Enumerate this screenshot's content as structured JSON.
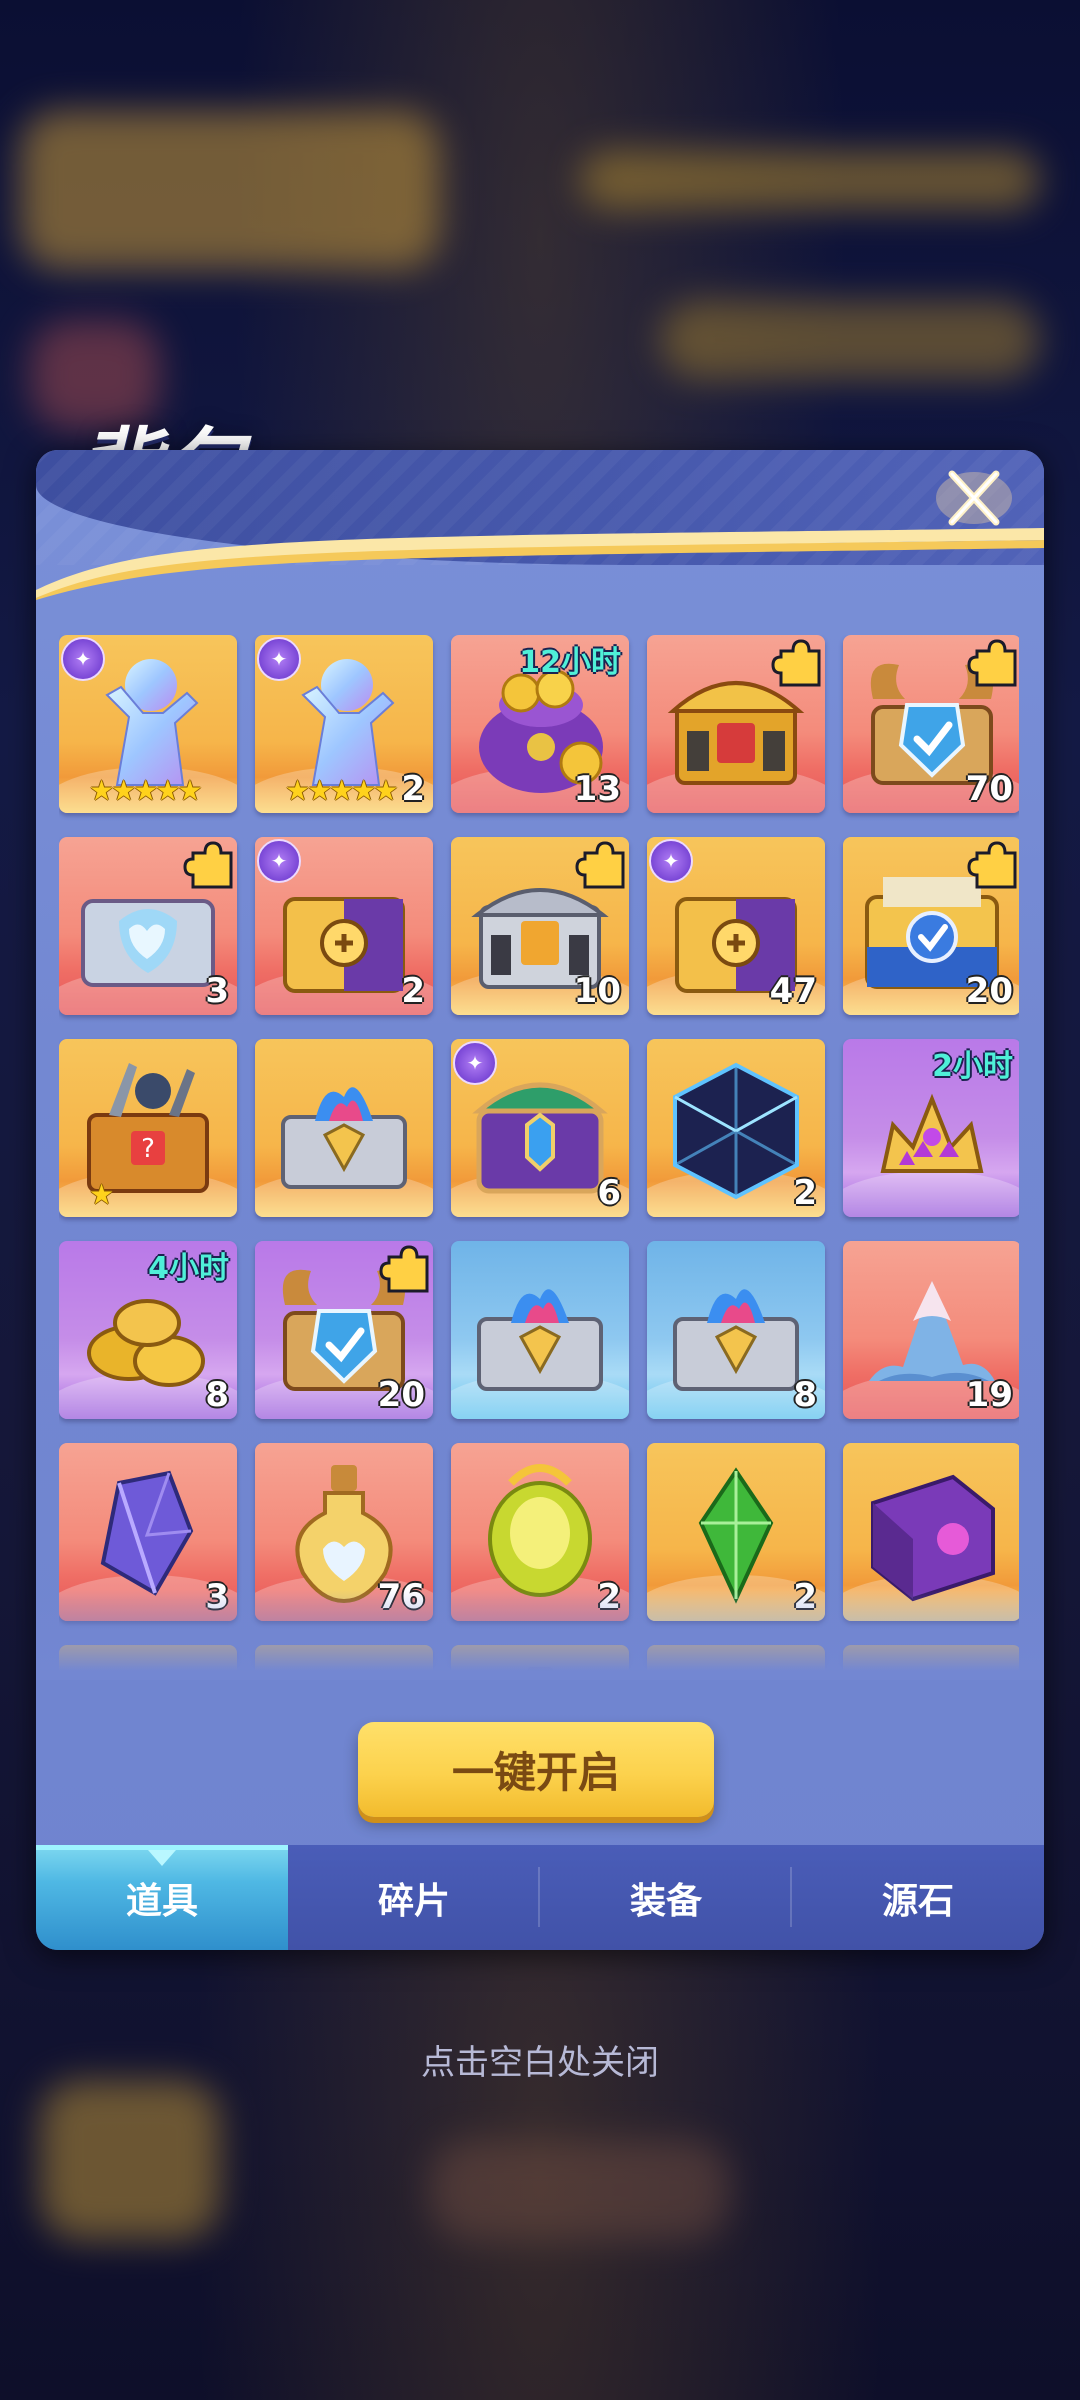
{
  "title": "背包",
  "open_all_label": "一键开启",
  "close_hint": "点击空白处关闭",
  "tabs": [
    {
      "label": "道具",
      "active": true
    },
    {
      "label": "碎片",
      "active": false
    },
    {
      "label": "装备",
      "active": false
    },
    {
      "label": "源石",
      "active": false
    }
  ],
  "items": [
    {
      "name": "crystal-hero-4star",
      "bg": "orange",
      "count": "",
      "timer": "",
      "stars": "★★★★★",
      "badge": true,
      "puzzle": false,
      "icon": "crystal-figure"
    },
    {
      "name": "crystal-hero-4star-b",
      "bg": "orange",
      "count": "2",
      "timer": "",
      "stars": "★★★★★",
      "badge": true,
      "puzzle": false,
      "icon": "crystal-figure"
    },
    {
      "name": "coin-bag",
      "bg": "red",
      "count": "13",
      "timer": "12小时",
      "stars": "",
      "badge": false,
      "puzzle": false,
      "icon": "coin-bag"
    },
    {
      "name": "golden-chest-fragment",
      "bg": "red",
      "count": "",
      "timer": "",
      "stars": "",
      "badge": false,
      "puzzle": true,
      "icon": "chest-red"
    },
    {
      "name": "horned-chest-fragment",
      "bg": "red",
      "count": "70",
      "timer": "",
      "stars": "",
      "badge": false,
      "puzzle": true,
      "icon": "chest-horned"
    },
    {
      "name": "heart-chest-fragment",
      "bg": "red",
      "count": "3",
      "timer": "",
      "stars": "",
      "badge": false,
      "puzzle": true,
      "icon": "chest-heart"
    },
    {
      "name": "purple-gold-chest",
      "bg": "red",
      "count": "2",
      "timer": "",
      "stars": "",
      "badge": true,
      "puzzle": false,
      "icon": "chest-purple"
    },
    {
      "name": "silver-chest-fragment",
      "bg": "orange",
      "count": "10",
      "timer": "",
      "stars": "",
      "badge": false,
      "puzzle": true,
      "icon": "chest-silver"
    },
    {
      "name": "purple-gold-chest-b",
      "bg": "orange",
      "count": "47",
      "timer": "",
      "stars": "",
      "badge": true,
      "puzzle": false,
      "icon": "chest-purple"
    },
    {
      "name": "blue-shield-chest-fragment",
      "bg": "orange",
      "count": "20",
      "timer": "",
      "stars": "",
      "badge": false,
      "puzzle": true,
      "icon": "chest-blue"
    },
    {
      "name": "weapon-chest",
      "bg": "orange",
      "count": "",
      "timer": "",
      "stars": "★",
      "badge": false,
      "puzzle": false,
      "icon": "chest-weapons"
    },
    {
      "name": "fire-chest",
      "bg": "orange",
      "count": "",
      "timer": "",
      "stars": "",
      "badge": false,
      "puzzle": false,
      "icon": "chest-fire"
    },
    {
      "name": "element-chest",
      "bg": "orange",
      "count": "6",
      "timer": "",
      "stars": "",
      "badge": true,
      "puzzle": false,
      "icon": "chest-element"
    },
    {
      "name": "dark-cube",
      "bg": "orange",
      "count": "2",
      "timer": "",
      "stars": "",
      "badge": false,
      "puzzle": false,
      "icon": "cube"
    },
    {
      "name": "purple-gem-crowns",
      "bg": "purple",
      "count": "",
      "timer": "2小时",
      "stars": "",
      "badge": false,
      "puzzle": false,
      "icon": "crowns"
    },
    {
      "name": "gold-coins",
      "bg": "purple",
      "count": "8",
      "timer": "4小时",
      "stars": "",
      "badge": false,
      "puzzle": false,
      "icon": "coins"
    },
    {
      "name": "horned-purple-chest-fragment",
      "bg": "purple",
      "count": "20",
      "timer": "",
      "stars": "",
      "badge": false,
      "puzzle": true,
      "icon": "chest-horned"
    },
    {
      "name": "blue-fire-chest",
      "bg": "blue",
      "count": "",
      "timer": "",
      "stars": "",
      "badge": false,
      "puzzle": false,
      "icon": "chest-fire"
    },
    {
      "name": "blue-flame-chest",
      "bg": "blue",
      "count": "8",
      "timer": "",
      "stars": "",
      "badge": false,
      "puzzle": false,
      "icon": "chest-fire"
    },
    {
      "name": "crystal-mountain",
      "bg": "red",
      "count": "19",
      "timer": "",
      "stars": "",
      "badge": false,
      "puzzle": false,
      "icon": "mountain"
    },
    {
      "name": "purple-crystal",
      "bg": "red",
      "count": "3",
      "timer": "",
      "stars": "",
      "badge": false,
      "puzzle": false,
      "icon": "crystal"
    },
    {
      "name": "heart-potion",
      "bg": "red",
      "count": "76",
      "timer": "",
      "stars": "",
      "badge": false,
      "puzzle": false,
      "icon": "potion"
    },
    {
      "name": "golden-egg",
      "bg": "red",
      "count": "2",
      "timer": "",
      "stars": "",
      "badge": false,
      "puzzle": false,
      "icon": "egg"
    },
    {
      "name": "green-gem",
      "bg": "orange",
      "count": "2",
      "timer": "",
      "stars": "",
      "badge": false,
      "puzzle": false,
      "icon": "green-gem"
    },
    {
      "name": "purple-book",
      "bg": "orange",
      "count": "",
      "timer": "",
      "stars": "",
      "badge": false,
      "puzzle": false,
      "icon": "book"
    },
    {
      "name": "partial-item-1",
      "bg": "orange",
      "count": "",
      "timer": "",
      "stars": "",
      "badge": false,
      "puzzle": false,
      "icon": "chest-red"
    },
    {
      "name": "partial-item-2",
      "bg": "orange",
      "count": "",
      "timer": "",
      "stars": "",
      "badge": false,
      "puzzle": false,
      "icon": "crystal"
    },
    {
      "name": "partial-item-3",
      "bg": "orange",
      "count": "",
      "timer": "",
      "stars": "",
      "badge": false,
      "puzzle": false,
      "icon": "potion"
    },
    {
      "name": "partial-item-4",
      "bg": "orange",
      "count": "",
      "timer": "",
      "stars": "",
      "badge": false,
      "puzzle": false,
      "icon": "green-gem"
    },
    {
      "name": "partial-item-5",
      "bg": "orange",
      "count": "",
      "timer": "",
      "stars": "",
      "badge": false,
      "puzzle": false,
      "icon": "coins"
    }
  ]
}
